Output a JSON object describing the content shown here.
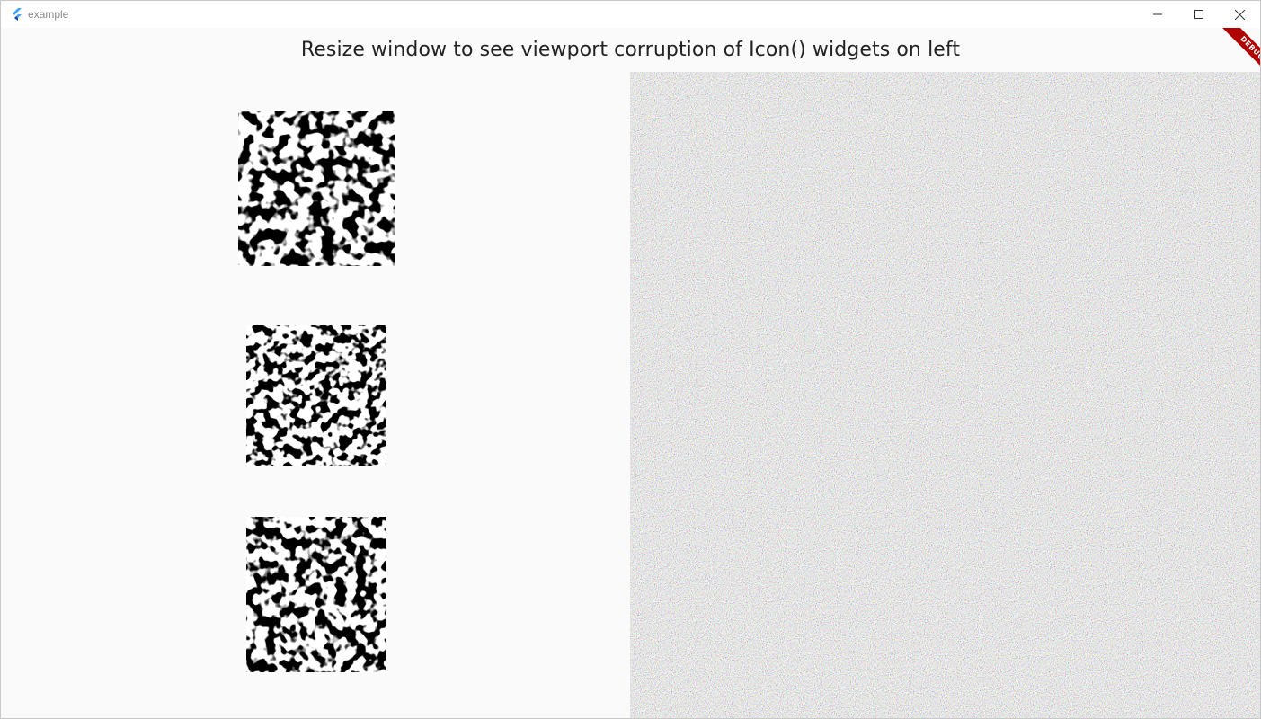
{
  "window": {
    "title": "example",
    "controls": {
      "minimize": "minimize-icon",
      "maximize": "maximize-icon",
      "close": "close-icon"
    }
  },
  "content": {
    "headline": "Resize window to see viewport corruption of Icon() widgets on left",
    "debug_banner": "DEBUG"
  },
  "icons": [
    {
      "name": "corrupted-icon-1",
      "semantic": "noise-pattern-icon"
    },
    {
      "name": "corrupted-icon-2",
      "semantic": "noise-pattern-icon"
    },
    {
      "name": "corrupted-icon-3",
      "semantic": "noise-pattern-icon"
    }
  ],
  "colors": {
    "title_text": "#222222",
    "background": "#f9f9f9",
    "noise_dark": "#1a1a1a",
    "debug_red": "#b00000",
    "flutter_blue": "#42a5f5"
  }
}
